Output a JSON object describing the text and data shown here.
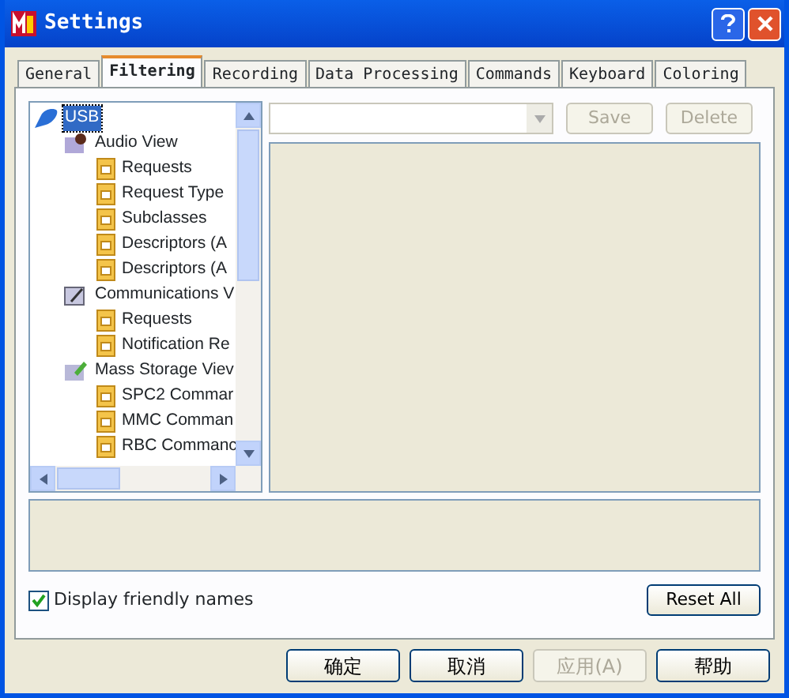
{
  "window": {
    "title": "Settings"
  },
  "tabs": [
    {
      "label": "General",
      "selected": false
    },
    {
      "label": "Filtering",
      "selected": true
    },
    {
      "label": "Recording",
      "selected": false
    },
    {
      "label": "Data Processing",
      "selected": false
    },
    {
      "label": "Commands",
      "selected": false
    },
    {
      "label": "Keyboard",
      "selected": false
    },
    {
      "label": "Coloring",
      "selected": false
    }
  ],
  "tree": [
    {
      "label": "USB",
      "kind": "root",
      "selected": true,
      "children": [
        {
          "label": "Audio View",
          "kind": "audio",
          "selected": false,
          "children": [
            {
              "label": "Requests",
              "kind": "leaf",
              "selected": false
            },
            {
              "label": "Request Type",
              "kind": "leaf",
              "selected": false
            },
            {
              "label": "Subclasses",
              "kind": "leaf",
              "selected": false
            },
            {
              "label": "Descriptors (A",
              "kind": "leaf",
              "selected": false
            },
            {
              "label": "Descriptors (A",
              "kind": "leaf",
              "selected": false
            }
          ]
        },
        {
          "label": "Communications V",
          "kind": "comm",
          "selected": false,
          "children": [
            {
              "label": "Requests",
              "kind": "leaf",
              "selected": false
            },
            {
              "label": "Notification Re",
              "kind": "leaf",
              "selected": false
            }
          ]
        },
        {
          "label": "Mass Storage Viev",
          "kind": "storage",
          "selected": false,
          "children": [
            {
              "label": "SPC2 Commar",
              "kind": "leaf",
              "selected": false
            },
            {
              "label": "MMC Comman",
              "kind": "leaf",
              "selected": false
            },
            {
              "label": "RBC Commanc",
              "kind": "leaf",
              "selected": false
            }
          ]
        }
      ]
    }
  ],
  "filter_toolbar": {
    "save": {
      "label": "Save",
      "disabled": true
    },
    "delete": {
      "label": "Delete",
      "disabled": true
    }
  },
  "display_friendly_names": {
    "label": "Display friendly names",
    "checked": true
  },
  "reset_all": {
    "label": "Reset All"
  },
  "buttons": [
    {
      "label": "确定",
      "disabled": false
    },
    {
      "label": "取消",
      "disabled": false
    },
    {
      "label": "应用(A)",
      "disabled": true
    },
    {
      "label": "帮助",
      "disabled": false
    }
  ]
}
